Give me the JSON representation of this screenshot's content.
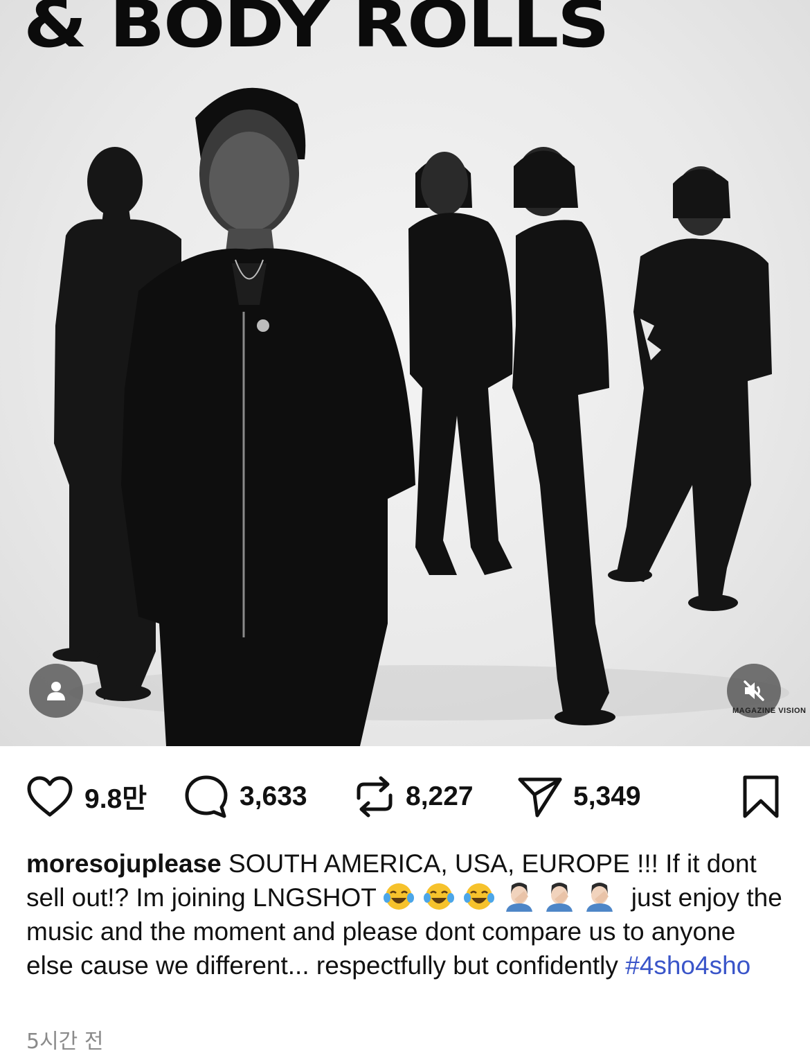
{
  "post": {
    "banner_text": "& BODY ROLLS",
    "photo_credit": "MAGAZINE VISION"
  },
  "actions": {
    "likes": "9.8만",
    "comments": "3,633",
    "reposts": "8,227",
    "shares": "5,349"
  },
  "caption": {
    "username": "moresojuplease",
    "text_1": "SOUTH AMERICA, USA, EUROPE !!! If it dont sell out!? Im joining LNGSHOT",
    "text_2": "just enjoy the music and the moment and please dont compare us to anyone else cause we different... respectfully but confidently",
    "hashtag": "#4sho4sho",
    "emojis": [
      "tears-of-joy",
      "tears-of-joy",
      "tears-of-joy",
      "facepalm",
      "facepalm",
      "facepalm"
    ]
  },
  "timestamp": "5시간 전",
  "icons": {
    "user": "user-icon",
    "mute": "muted-speaker-icon",
    "like": "heart-icon",
    "comment": "comment-bubble-icon",
    "repost": "repost-icon",
    "share": "paper-plane-icon",
    "bookmark": "bookmark-icon"
  },
  "colors": {
    "hashtag": "#3a55c9",
    "timestamp": "#8a8a8a"
  }
}
